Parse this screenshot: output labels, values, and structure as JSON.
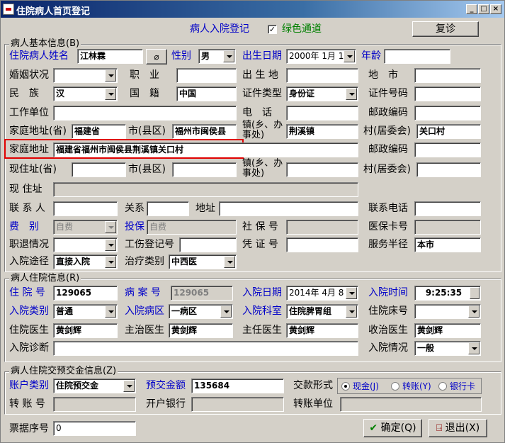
{
  "window": {
    "title": "住院病人首页登记"
  },
  "toolbar": {
    "admit_label": "病人入院登记",
    "green_channel": "绿色通道",
    "green_checked": "✓",
    "reset_label": "复诊"
  },
  "basic": {
    "group_title": "病人基本信息(B)",
    "name_label": "住院病人姓名",
    "name": "江林霖",
    "gender_label": "性别",
    "gender": "男",
    "dob_label": "出生日期",
    "dob": "2000年 1月 1",
    "age_label": "年龄",
    "age": "",
    "marital_label": "婚姻状况",
    "marital": "",
    "job_label": "职　业",
    "job": "",
    "birthplace_label": "出 生 地",
    "birthplace": "",
    "city_label": "地　市",
    "city": "",
    "ethnic_label": "民　族",
    "ethnic": "汉",
    "nation_label": "国　籍",
    "nation": "中国",
    "idtype_label": "证件类型",
    "idtype": "身份证",
    "idno_label": "证件号码",
    "idno": "",
    "workplace_label": "工作单位",
    "workplace": "",
    "phone_label": "电　话",
    "phone": "",
    "postcode_label": "邮政编码",
    "postcode": "",
    "home_prov_label": "家庭地址(省)",
    "home_prov": "福建省",
    "home_city_label": "市(县区)",
    "home_city": "福州市闽侯县",
    "home_town_label": "镇(乡、办事处)",
    "home_town": "荆溪镇",
    "home_village_label": "村(居委会)",
    "home_village": "关口村",
    "home_addr_label": "家庭地址",
    "home_addr": "福建省福州市闽侯县荆溪镇关口村",
    "home_post_label": "邮政编码",
    "home_post": "",
    "cur_prov_label": "现住址(省)",
    "cur_prov": "",
    "cur_city_label": "市(县区)",
    "cur_city": "",
    "cur_town_label": "镇(乡、办事处)",
    "cur_town": "",
    "cur_village_label": "村(居委会)",
    "cur_village": "",
    "cur_addr_label": "现 住址",
    "cur_addr": "",
    "contact_label": "联 系 人",
    "contact": "",
    "relation_label": "关系",
    "relation": "",
    "contact_addr_label": "地址",
    "contact_addr": "",
    "contact_phone_label": "联系电话",
    "contact_phone": "",
    "fee_label": "费　别",
    "fee": "自费",
    "insure_label": "投保",
    "insure": "自费",
    "social_label": "社 保 号",
    "social": "",
    "medcard_label": "医保卡号",
    "medcard": "",
    "retire_label": "职退情况",
    "retire": "",
    "injury_label": "工伤登记号",
    "injury": "",
    "voucher_label": "凭 证 号",
    "voucher": "",
    "radius_label": "服务半径",
    "radius": "本市",
    "route_label": "入院途径",
    "route": "直接入院",
    "treat_label": "治疗类别",
    "treat": "中西医"
  },
  "hosp": {
    "group_title": "病人住院信息(R)",
    "inpatient_no_label": "住 院 号",
    "inpatient_no": "129065",
    "record_no_label": "病 案 号",
    "record_no": "129065",
    "admit_date_label": "入院日期",
    "admit_date": "2014年 4月 8",
    "admit_time_label": "入院时间",
    "admit_time": "9:25:35",
    "admit_type_label": "入院类别",
    "admit_type": "普通",
    "ward_label": "入院病区",
    "ward": "一病区",
    "dept_label": "入院科室",
    "dept": "住院脾胃组",
    "bed_label": "住院床号",
    "bed": "",
    "doctor_label": "住院医生",
    "doctor": "黄剑辉",
    "attending_label": "主治医生",
    "attending": "黄剑辉",
    "chief_label": "主任医生",
    "chief": "黄剑辉",
    "receiving_label": "收治医生",
    "receiving": "黄剑辉",
    "diag_label": "入院诊断",
    "diag": "",
    "condition_label": "入院情况",
    "condition": "一般"
  },
  "deposit": {
    "group_title": "病人住院交预交金信息(Z)",
    "acct_label": "账户类别",
    "acct": "住院预交金",
    "amount_label": "预交金额",
    "amount": "135684",
    "pay_label": "交款形式",
    "cash": "现金(J)",
    "transfer": "转账(Y)",
    "card": "银行卡",
    "transfer_no_label": "转 账 号",
    "transfer_no": "",
    "bank_label": "开户银行",
    "bank": "",
    "transfer_unit_label": "转账单位",
    "transfer_unit": ""
  },
  "footer": {
    "receipt_label": "票据序号",
    "receipt": "0",
    "ok_label": "确定(Q)",
    "exit_label": "退出(X)"
  },
  "colors": {
    "highlight": "#e00000",
    "label_blue": "#0000c8",
    "label_green": "#008000",
    "titlebar": "#0a246a"
  }
}
